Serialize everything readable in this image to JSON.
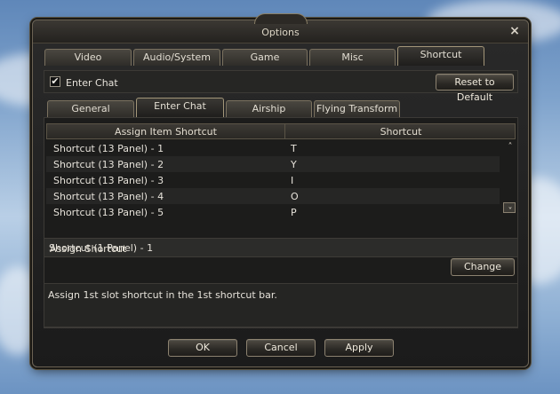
{
  "window": {
    "title": "Options"
  },
  "main_tabs": [
    {
      "label": "Video"
    },
    {
      "label": "Audio/System"
    },
    {
      "label": "Game"
    },
    {
      "label": "Misc"
    },
    {
      "label": "Shortcut"
    }
  ],
  "enter_chat_checkbox": {
    "label": "Enter Chat",
    "checked": true,
    "mark": "✔"
  },
  "reset_button": {
    "label": "Reset to Default"
  },
  "sub_tabs": [
    {
      "label": "General"
    },
    {
      "label": "Enter Chat"
    },
    {
      "label": "Airship"
    },
    {
      "label": "Flying Transform"
    }
  ],
  "table": {
    "headers": [
      "Assign Item Shortcut",
      "Shortcut"
    ],
    "rows": [
      {
        "name": "Shortcut (13 Panel) - 1",
        "key": "T"
      },
      {
        "name": "Shortcut (13 Panel) - 2",
        "key": "Y"
      },
      {
        "name": "Shortcut (13 Panel) - 3",
        "key": "I"
      },
      {
        "name": "Shortcut (13 Panel) - 4",
        "key": "O"
      },
      {
        "name": "Shortcut (13 Panel) - 5",
        "key": "P"
      }
    ]
  },
  "assign": {
    "title": "Assign Shortcut",
    "value": "Shortcut (1 Panel) - 1",
    "change_label": "Change"
  },
  "description": "Assign 1st slot shortcut in the 1st shortcut bar.",
  "footer": {
    "ok": "OK",
    "cancel": "Cancel",
    "apply": "Apply"
  },
  "icons": {
    "close": "×",
    "scroll_up": "˄",
    "scroll_down": "˅"
  }
}
